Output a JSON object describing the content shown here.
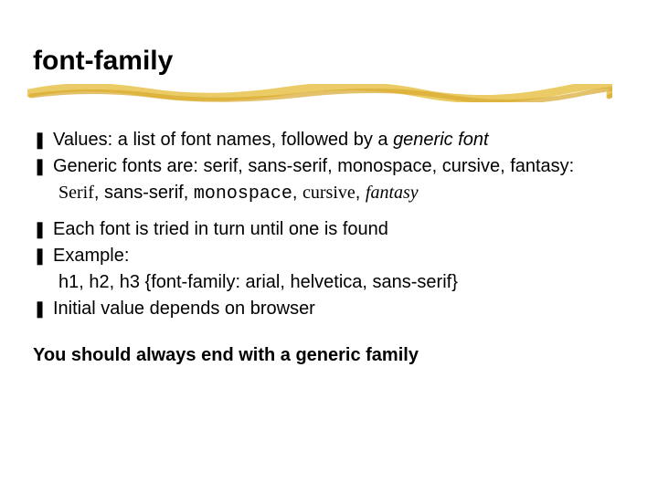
{
  "title": "font-family",
  "bullets": {
    "b1_prefix": "Values: a list of font names, followed by a ",
    "b1_italic": "generic font",
    "b2": "Generic fonts are: serif, sans-serif, monospace, cursive, fantasy:",
    "b2_samples": {
      "serif": "Serif",
      "sep1": ", ",
      "sans": "sans-serif",
      "sep2": ", ",
      "mono": "monospace",
      "sep3": ", ",
      "cursive": "cursive",
      "sep4": ", ",
      "fantasy": "fantasy"
    },
    "b3": "Each font is tried in turn until one is found",
    "b4": "Example:",
    "b4_sub": "h1, h2, h3 {font-family: arial, helvetica, sans-serif}",
    "b5": "Initial value depends on browser"
  },
  "closing": "You should always end with a generic family",
  "bullet_glyph": "❚"
}
